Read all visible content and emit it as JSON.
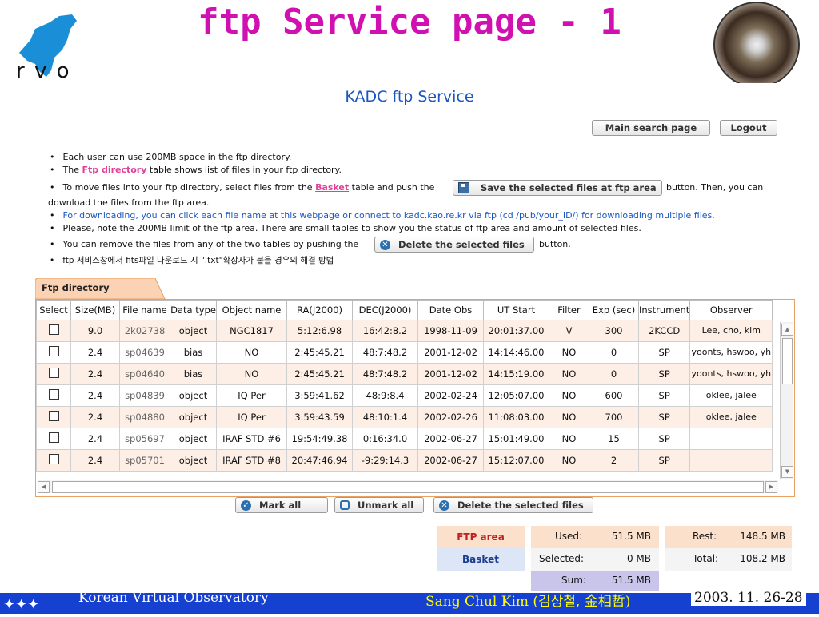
{
  "slide": {
    "title": "ftp Service page - 1",
    "logo_text": "r v o",
    "footer_left": "Korean Virtual Observatory",
    "footer_mid": "Sang Chul Kim (김상철, 金相哲)",
    "footer_right": "2003. 11. 26-28"
  },
  "page": {
    "title": "KADC ftp Service",
    "main_search_label": "Main search page",
    "logout_label": "Logout"
  },
  "instructions": {
    "l1": "Each user can use 200MB space in the ftp directory.",
    "l2_pre": "The ",
    "l2_hl": "Ftp directory",
    "l2_post": " table shows list of files in your ftp directory.",
    "l3_pre": "To move files into your ftp directory, select files from the ",
    "l3_hl": "Basket",
    "l3_post": " table and push the",
    "save_button": "Save the selected files at ftp area",
    "l3_tail": "button. Then, you can",
    "l4": "download the files from the ftp area.",
    "l5": "For downloading, you can click each file name at this webpage or connect to kadc.kao.re.kr via ftp (cd /pub/your_ID/) for downloading multiple files.",
    "l6": "Please, note the 200MB limit of the ftp area. There are small tables to show you the status of ftp area and amount of selected files.",
    "l7_pre": "You can remove the files from any of the two tables by pushing the",
    "delete_button": "Delete the selected files",
    "l7_post": "button.",
    "l8": "ftp 서비스창에서 fits파일 다운로드 시 \".txt\"확장자가 붙을 경우의 해결 방법"
  },
  "ftp_table": {
    "tab_label": "Ftp directory",
    "headers": [
      "Select",
      "Size(MB)",
      "File name",
      "Data type",
      "Object name",
      "RA(J2000)",
      "DEC(J2000)",
      "Date Obs",
      "UT Start",
      "Filter",
      "Exp (sec)",
      "Instrument",
      "Observer"
    ],
    "rows": [
      [
        "9.0",
        "2k02738",
        "object",
        "NGC1817",
        "5:12:6.98",
        "16:42:8.2",
        "1998-11-09",
        "20:01:37.00",
        "V",
        "300",
        "2KCCD",
        "Lee, cho, kim"
      ],
      [
        "2.4",
        "sp04639",
        "bias",
        "NO",
        "2:45:45.21",
        "48:7:48.2",
        "2001-12-02",
        "14:14:46.00",
        "NO",
        "0",
        "SP",
        "yoonts, hswoo, yh"
      ],
      [
        "2.4",
        "sp04640",
        "bias",
        "NO",
        "2:45:45.21",
        "48:7:48.2",
        "2001-12-02",
        "14:15:19.00",
        "NO",
        "0",
        "SP",
        "yoonts, hswoo, yh"
      ],
      [
        "2.4",
        "sp04839",
        "object",
        "IQ Per",
        "3:59:41.62",
        "48:9:8.4",
        "2002-02-24",
        "12:05:07.00",
        "NO",
        "600",
        "SP",
        "oklee, jalee"
      ],
      [
        "2.4",
        "sp04880",
        "object",
        "IQ Per",
        "3:59:43.59",
        "48:10:1.4",
        "2002-02-26",
        "11:08:03.00",
        "NO",
        "700",
        "SP",
        "oklee, jalee"
      ],
      [
        "2.4",
        "sp05697",
        "object",
        "IRAF STD #6",
        "19:54:49.38",
        "0:16:34.0",
        "2002-06-27",
        "15:01:49.00",
        "NO",
        "15",
        "SP",
        ""
      ],
      [
        "2.4",
        "sp05701",
        "object",
        "IRAF STD #8",
        "20:47:46.94",
        "-9:29:14.3",
        "2002-06-27",
        "15:12:07.00",
        "NO",
        "2",
        "SP",
        ""
      ]
    ]
  },
  "actions": {
    "mark_all": "Mark all",
    "unmark_all": "Unmark all",
    "delete_selected": "Delete the selected files"
  },
  "status": {
    "ftp_area_label": "FTP area",
    "basket_label": "Basket",
    "used_label": "Used:",
    "used_value": "51.5 MB",
    "selected_label": "Selected:",
    "selected_value": "0 MB",
    "sum_label": "Sum:",
    "sum_value": "51.5 MB",
    "rest_label": "Rest:",
    "rest_value": "148.5 MB",
    "total_label": "Total:",
    "total_value": "108.2 MB"
  },
  "colors": {
    "title": "#d010b0",
    "accent_blue": "#1a56c0",
    "row_alt": "#fdefe6",
    "footer_band": "#1540d0"
  }
}
